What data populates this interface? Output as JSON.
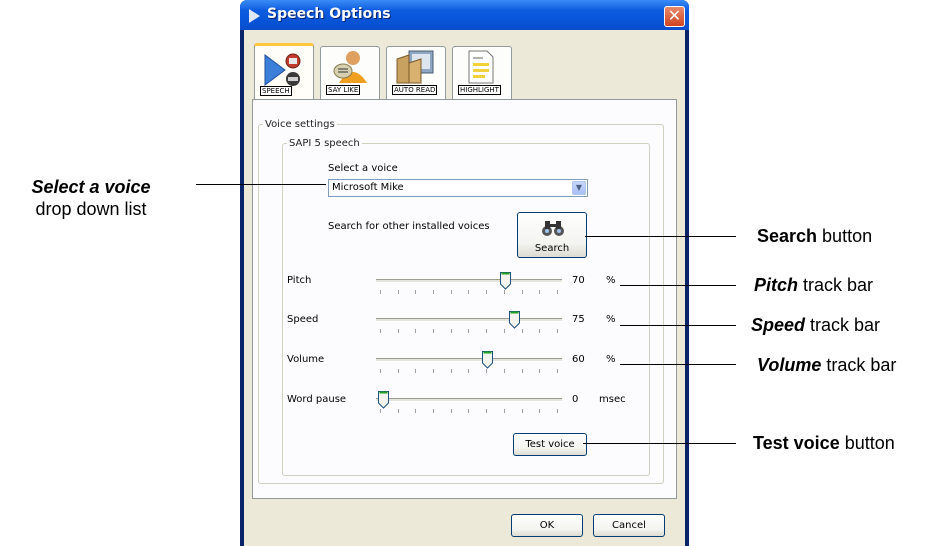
{
  "window": {
    "title": "Speech Options",
    "close_glyph": "✕"
  },
  "tabs": [
    {
      "label": "SPEECH",
      "icon": "speech-icon"
    },
    {
      "label": "SAY LIKE",
      "icon": "say-like-icon"
    },
    {
      "label": "AUTO READ",
      "icon": "auto-read-icon"
    },
    {
      "label": "HIGHLIGHT",
      "icon": "highlight-icon"
    }
  ],
  "voice_settings": {
    "group_label": "Voice settings",
    "sapi_label": "SAPI 5 speech",
    "select_label": "Select a voice",
    "selected_voice": "Microsoft Mike",
    "search_prompt": "Search for other installed voices",
    "search_button": "Search"
  },
  "sliders": [
    {
      "label": "Pitch",
      "value": "70",
      "unit": "%",
      "level": 0.7
    },
    {
      "label": "Speed",
      "value": "75",
      "unit": "%",
      "level": 0.75
    },
    {
      "label": "Volume",
      "value": "60",
      "unit": "%",
      "level": 0.6
    },
    {
      "label": "Word pause",
      "value": "0",
      "unit": "msec",
      "level": 0
    }
  ],
  "buttons": {
    "test_voice": "Test voice",
    "ok": "OK",
    "cancel": "Cancel"
  },
  "annotations": {
    "select_voice": {
      "bold": "Select a voice",
      "rest": "drop down list"
    },
    "search": {
      "bold": "Search",
      "rest": " button"
    },
    "pitch": {
      "bold": "Pitch",
      "rest": " track bar"
    },
    "speed": {
      "bold": "Speed",
      "rest": " track bar"
    },
    "volume": {
      "bold": "Volume",
      "rest": " track bar"
    },
    "test_voice": {
      "bold": "Test voice",
      "rest": " button"
    }
  }
}
